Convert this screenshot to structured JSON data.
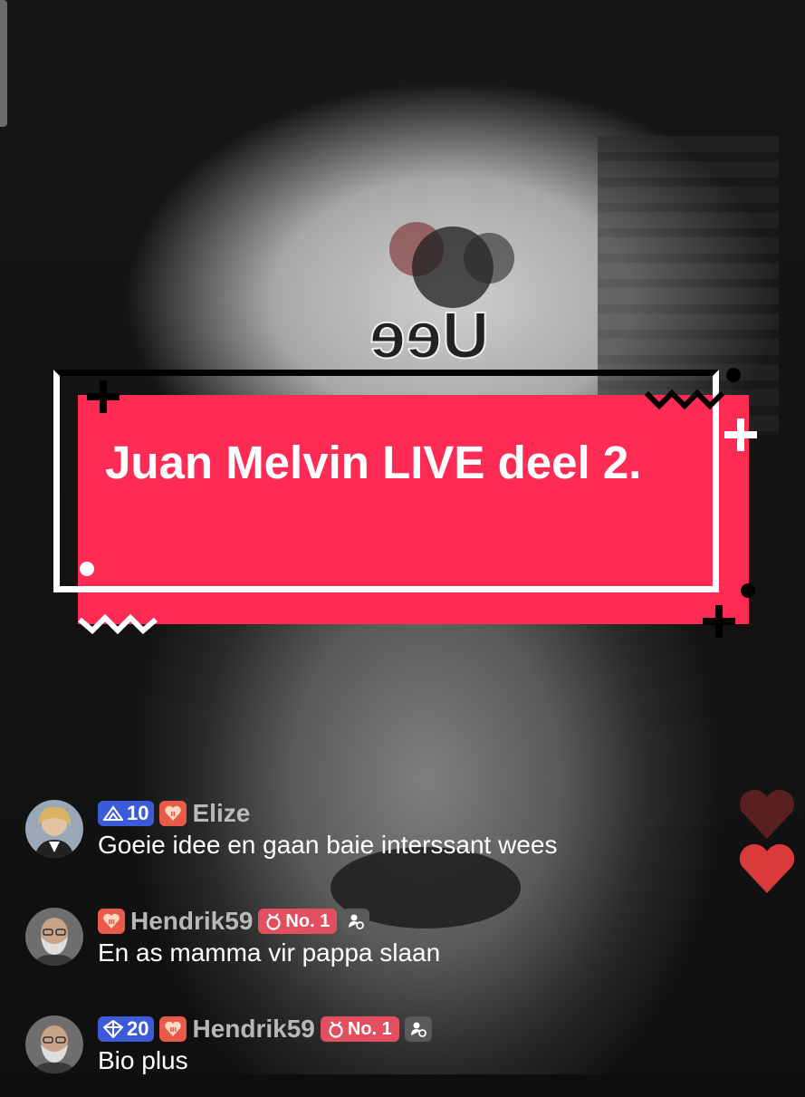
{
  "banner": {
    "title": "Juan Melvin LIVE deel 2."
  },
  "cap": {
    "logo_text": "ɘɘU"
  },
  "comments": [
    {
      "level": "10",
      "username": "Elize",
      "rank": "",
      "message": "Goeie idee en gaan baie interssant wees"
    },
    {
      "level": "",
      "username": "Hendrik59",
      "rank": "No. 1",
      "message": "En as mamma vir pappa slaan"
    },
    {
      "level": "20",
      "username": "Hendrik59",
      "rank": "No. 1",
      "message": "Bio plus"
    }
  ],
  "colors": {
    "banner": "#fe2c55",
    "level_badge": "#3b5bd8",
    "heart": "#d93b3b"
  },
  "icons": [
    "crown-icon",
    "heart-badge-icon",
    "medal-icon",
    "moderator-icon",
    "like-heart-icon"
  ]
}
